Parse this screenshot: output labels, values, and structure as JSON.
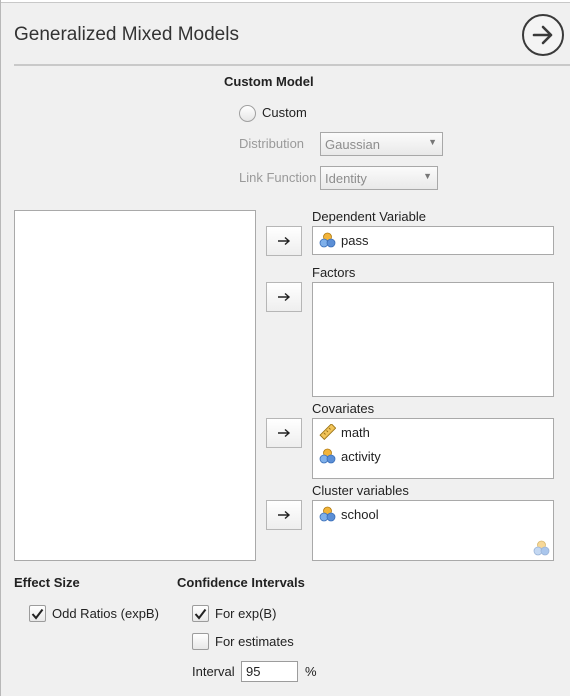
{
  "window": {
    "title": "Generalized Mixed Models"
  },
  "custom_model": {
    "heading": "Custom Model",
    "custom_label": "Custom",
    "distribution_label": "Distribution",
    "distribution_value": "Gaussian",
    "link_label": "Link Function",
    "link_value": "Identity"
  },
  "variables": {
    "dependent": {
      "label": "Dependent Variable",
      "items": [
        {
          "name": "pass",
          "icon": "nominal-icon"
        }
      ]
    },
    "factors": {
      "label": "Factors",
      "items": []
    },
    "covariates": {
      "label": "Covariates",
      "items": [
        {
          "name": "math",
          "icon": "continuous-ruler-icon"
        },
        {
          "name": "activity",
          "icon": "nominal-icon"
        }
      ]
    },
    "cluster": {
      "label": "Cluster variables",
      "items": [
        {
          "name": "school",
          "icon": "nominal-icon"
        }
      ]
    }
  },
  "effect_size": {
    "heading": "Effect Size",
    "odd_ratios_label": "Odd Ratios (expB)",
    "odd_ratios_checked": true
  },
  "confidence": {
    "heading": "Confidence Intervals",
    "exp_b_label": "For exp(B)",
    "exp_b_checked": true,
    "estimates_label": "For estimates",
    "estimates_checked": false,
    "interval_label": "Interval",
    "interval_value": "95",
    "interval_unit": "%"
  },
  "colors": {
    "accent_border": "#a9a9a9",
    "icon_orange": "#f2b43a",
    "icon_blue": "#5b8fd6"
  }
}
